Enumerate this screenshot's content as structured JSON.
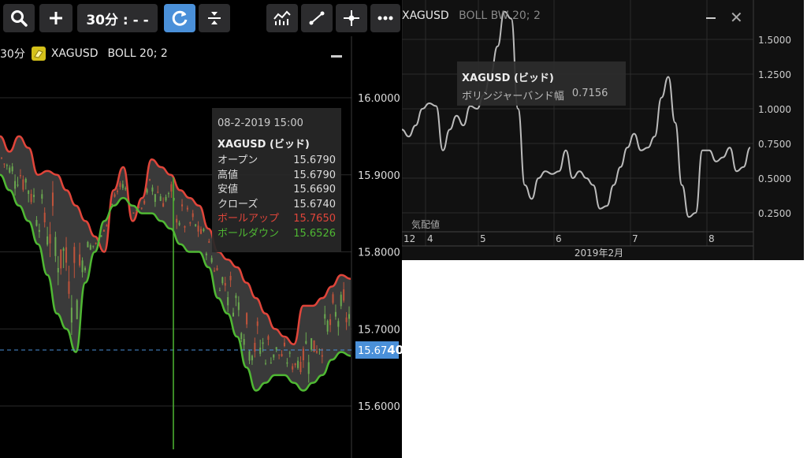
{
  "toolbar": {
    "timeframe_label": "30分 : - -",
    "buttons": [
      "search-icon",
      "plus-icon",
      "timeframe",
      "refresh-icon",
      "split-icon",
      "indicator-icon",
      "line-draw-icon",
      "crosshair-icon",
      "more-icon"
    ]
  },
  "main_chart": {
    "timeframe": "30分",
    "instrument": "XAGUSD",
    "indicator": "BOLL 20; 2",
    "current_price_main": "15.67",
    "current_price_emph": "40",
    "colors": {
      "background": "#000000",
      "upper_band": "#e0453a",
      "lower_band": "#4fb833",
      "band_fill": "#3a3a3a",
      "candle_up": "#6aa84f",
      "candle_down": "#c0533a",
      "price_line": "#4a90d9"
    },
    "tooltip": {
      "datetime": "08-2-2019 15:00",
      "title": "XAGUSD (ビッド)",
      "rows": [
        {
          "label": "オープン",
          "value": "15.6790",
          "color": "#dddddd"
        },
        {
          "label": "高値",
          "value": "15.6790",
          "color": "#dddddd"
        },
        {
          "label": "安値",
          "value": "15.6690",
          "color": "#dddddd"
        },
        {
          "label": "クローズ",
          "value": "15.6740",
          "color": "#dddddd"
        },
        {
          "label": "ボールアップ",
          "value": "15.7650",
          "color": "#e0453a"
        },
        {
          "label": "ボールダウン",
          "value": "15.6526",
          "color": "#4fb833"
        }
      ]
    }
  },
  "sub_chart": {
    "instrument": "XAGUSD",
    "indicator": "BOLL BW 20; 2",
    "axis_note": "気配値",
    "tooltip": {
      "title": "XAGUSD (ビッド)",
      "label": "ボリンジャーバンド幅",
      "value": "0.7156"
    }
  },
  "chart_data": [
    {
      "type": "candlestick",
      "title": "XAGUSD BOLL 20; 2",
      "y_ticks": [
        "16.0000",
        "15.9000",
        "15.8000",
        "15.7000",
        "15.6000"
      ],
      "ylim": [
        15.58,
        16.04
      ],
      "upper_band": [
        15.95,
        15.93,
        15.95,
        15.935,
        15.9,
        15.905,
        15.9,
        15.88,
        15.86,
        15.84,
        15.82,
        15.8,
        15.88,
        15.91,
        15.84,
        15.87,
        15.92,
        15.91,
        15.9,
        15.88,
        15.87,
        15.86,
        15.83,
        15.8,
        15.79,
        15.78,
        15.76,
        15.74,
        15.72,
        15.7,
        15.69,
        15.68,
        15.73,
        15.73,
        15.74,
        15.755,
        15.77,
        15.765
      ],
      "lower_band": [
        15.9,
        15.88,
        15.86,
        15.84,
        15.81,
        15.77,
        15.72,
        15.7,
        15.67,
        15.76,
        15.8,
        15.84,
        15.86,
        15.87,
        15.86,
        15.85,
        15.85,
        15.84,
        15.83,
        15.81,
        15.8,
        15.8,
        15.78,
        15.74,
        15.72,
        15.69,
        15.65,
        15.62,
        15.63,
        15.64,
        15.64,
        15.63,
        15.62,
        15.63,
        15.64,
        15.66,
        15.67,
        15.665
      ],
      "last_close": 15.674,
      "series": [
        {
          "name": "ボールアップ",
          "color": "#e0453a"
        },
        {
          "name": "ボールダウン",
          "color": "#4fb833"
        }
      ]
    },
    {
      "type": "line",
      "title": "XAGUSD BOLL BW 20; 2",
      "x_ticks": [
        "12",
        "4",
        "5",
        "6",
        "7",
        "8"
      ],
      "x_label": "2019年2月",
      "y_ticks": [
        "1.5000",
        "1.2500",
        "1.0000",
        "0.7500",
        "0.5000",
        "0.2500"
      ],
      "ylim": [
        0.05,
        1.75
      ],
      "values": [
        0.85,
        0.8,
        0.88,
        1.0,
        1.04,
        1.02,
        0.7,
        0.85,
        0.95,
        0.88,
        1.02,
        1.0,
        1.1,
        1.25,
        1.45,
        1.7,
        1.65,
        1.0,
        0.45,
        0.35,
        0.5,
        0.55,
        0.53,
        0.55,
        0.7,
        0.5,
        0.55,
        0.5,
        0.45,
        0.28,
        0.3,
        0.45,
        0.58,
        0.72,
        0.82,
        0.7,
        0.72,
        0.8,
        1.08,
        1.23,
        0.9,
        0.45,
        0.22,
        0.25,
        0.7,
        0.7,
        0.62,
        0.65,
        0.72,
        0.55,
        0.58,
        0.72
      ]
    }
  ]
}
